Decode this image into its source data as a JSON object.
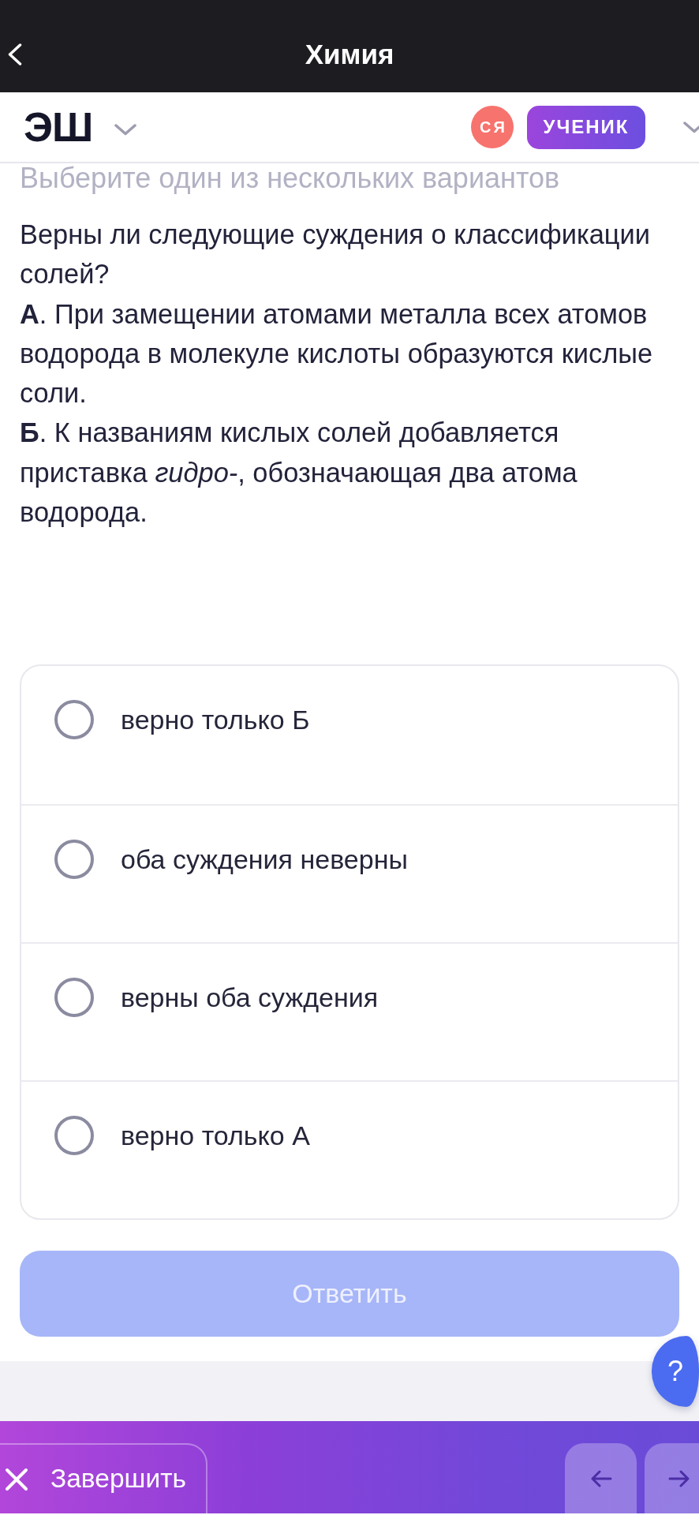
{
  "top_bar": {
    "title": "Химия"
  },
  "header": {
    "logo": "ЭШ",
    "avatar_initials": "СЯ",
    "role_badge": "УЧЕНИК"
  },
  "task": {
    "instruction": "Выберите один из нескольких вариантов",
    "paragraphs": [
      "Верны ли следующие суждения о классификации солей?",
      "**А**. При замещении атомами металла всех атомов водорода в молекуле кислоты образуются кислые соли.",
      "**Б**. К названиям кислых солей добавляется приставка *гидро-*, обозначающая два атома водорода."
    ]
  },
  "options": [
    {
      "label": "верно только Б",
      "selected": false
    },
    {
      "label": "оба суждения неверны",
      "selected": false
    },
    {
      "label": "верны оба суждения",
      "selected": false
    },
    {
      "label": "верно только А",
      "selected": false
    }
  ],
  "answer_button": {
    "label": "Ответить",
    "disabled": true
  },
  "help_button": {
    "label": "?"
  },
  "bottom_bar": {
    "finish_button": {
      "label": "Завершить"
    }
  }
}
